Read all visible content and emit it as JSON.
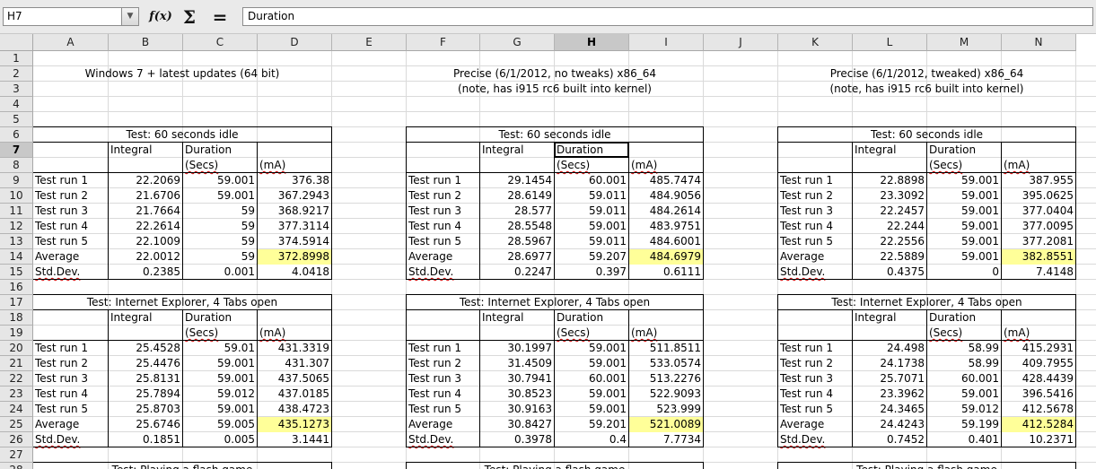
{
  "app": {
    "name_box": "H7",
    "formula": "Duration",
    "icons": {
      "function_wizard": "f(x)",
      "sum": "Σ",
      "formula": "="
    }
  },
  "columns": [
    "A",
    "B",
    "C",
    "D",
    "E",
    "F",
    "G",
    "H",
    "I",
    "J",
    "K",
    "L",
    "M",
    "N"
  ],
  "selected_column": "H",
  "rows": [
    "1",
    "2",
    "3",
    "4",
    "5",
    "6",
    "7",
    "8",
    "9",
    "10",
    "11",
    "12",
    "13",
    "14",
    "15",
    "16",
    "17",
    "18",
    "19",
    "20",
    "21",
    "22",
    "23",
    "24",
    "25",
    "26",
    "27",
    "28"
  ],
  "selected_row": "7",
  "headings": {
    "win": "Windows 7 + latest updates (64 bit)",
    "p1a": "Precise (6/1/2012, no tweaks) x86_64",
    "p1b": "(note, has i915 rc6 built into kernel)",
    "p2a": "Precise (6/1/2012, tweaked) x86_64",
    "p2b": "(note, has i915 rc6 built into kernel)"
  },
  "labels": {
    "test_idle": "Test:  60 seconds idle",
    "test_ie": "Test:  Internet Explorer, 4 Tabs open",
    "test_next": "Test:  Playing a flash game",
    "integral": "Integral",
    "duration": "Duration",
    "secs": "(Secs)",
    "ma": "(mA)",
    "runs": [
      "Test run  1",
      "Test run  2",
      "Test run  3",
      "Test run  4",
      "Test run  5"
    ],
    "average": "Average",
    "stddev": "Std.Dev."
  },
  "blocks": [
    {
      "id": "b1",
      "rows": [
        [
          "22.2069",
          "59.001",
          "376.38"
        ],
        [
          "21.6706",
          "59.001",
          "367.2943"
        ],
        [
          "21.7664",
          "59",
          "368.9217"
        ],
        [
          "22.2614",
          "59",
          "377.3114"
        ],
        [
          "22.1009",
          "59",
          "374.5914"
        ]
      ],
      "avg": [
        "22.0012",
        "59",
        "372.8998"
      ],
      "sd": [
        "0.2385",
        "0.001",
        "4.0418"
      ]
    },
    {
      "id": "b2",
      "rows": [
        [
          "29.1454",
          "60.001",
          "485.7474"
        ],
        [
          "28.6149",
          "59.011",
          "484.9056"
        ],
        [
          "28.577",
          "59.011",
          "484.2614"
        ],
        [
          "28.5548",
          "59.001",
          "483.9751"
        ],
        [
          "28.5967",
          "59.011",
          "484.6001"
        ]
      ],
      "avg": [
        "28.6977",
        "59.207",
        "484.6979"
      ],
      "sd": [
        "0.2247",
        "0.397",
        "0.6111"
      ]
    },
    {
      "id": "b3",
      "rows": [
        [
          "22.8898",
          "59.001",
          "387.955"
        ],
        [
          "23.3092",
          "59.001",
          "395.0625"
        ],
        [
          "22.2457",
          "59.001",
          "377.0404"
        ],
        [
          "22.244",
          "59.001",
          "377.0095"
        ],
        [
          "22.2556",
          "59.001",
          "377.2081"
        ]
      ],
      "avg": [
        "22.5889",
        "59.001",
        "382.8551"
      ],
      "sd": [
        "0.4375",
        "0",
        "7.4148"
      ]
    },
    {
      "id": "b4",
      "rows": [
        [
          "25.4528",
          "59.01",
          "431.3319"
        ],
        [
          "25.4476",
          "59.001",
          "431.307"
        ],
        [
          "25.8131",
          "59.001",
          "437.5065"
        ],
        [
          "25.7894",
          "59.012",
          "437.0185"
        ],
        [
          "25.8703",
          "59.001",
          "438.4723"
        ]
      ],
      "avg": [
        "25.6746",
        "59.005",
        "435.1273"
      ],
      "sd": [
        "0.1851",
        "0.005",
        "3.1441"
      ]
    },
    {
      "id": "b5",
      "rows": [
        [
          "30.1997",
          "59.001",
          "511.8511"
        ],
        [
          "31.4509",
          "59.001",
          "533.0574"
        ],
        [
          "30.7941",
          "60.001",
          "513.2276"
        ],
        [
          "30.8523",
          "59.001",
          "522.9093"
        ],
        [
          "30.9163",
          "59.001",
          "523.999"
        ]
      ],
      "avg": [
        "30.8427",
        "59.201",
        "521.0089"
      ],
      "sd": [
        "0.3978",
        "0.4",
        "7.7734"
      ]
    },
    {
      "id": "b6",
      "rows": [
        [
          "24.498",
          "58.99",
          "415.2931"
        ],
        [
          "24.1738",
          "58.99",
          "409.7955"
        ],
        [
          "25.7071",
          "60.001",
          "428.4439"
        ],
        [
          "23.3962",
          "59.001",
          "396.5416"
        ],
        [
          "24.3465",
          "59.012",
          "412.5678"
        ]
      ],
      "avg": [
        "24.4243",
        "59.199",
        "412.5284"
      ],
      "sd": [
        "0.7452",
        "0.401",
        "10.2371"
      ]
    }
  ],
  "colors": {
    "highlight": "#ffff99",
    "header_bg": "#e6e6e6",
    "grid": "#d8d8d8"
  }
}
